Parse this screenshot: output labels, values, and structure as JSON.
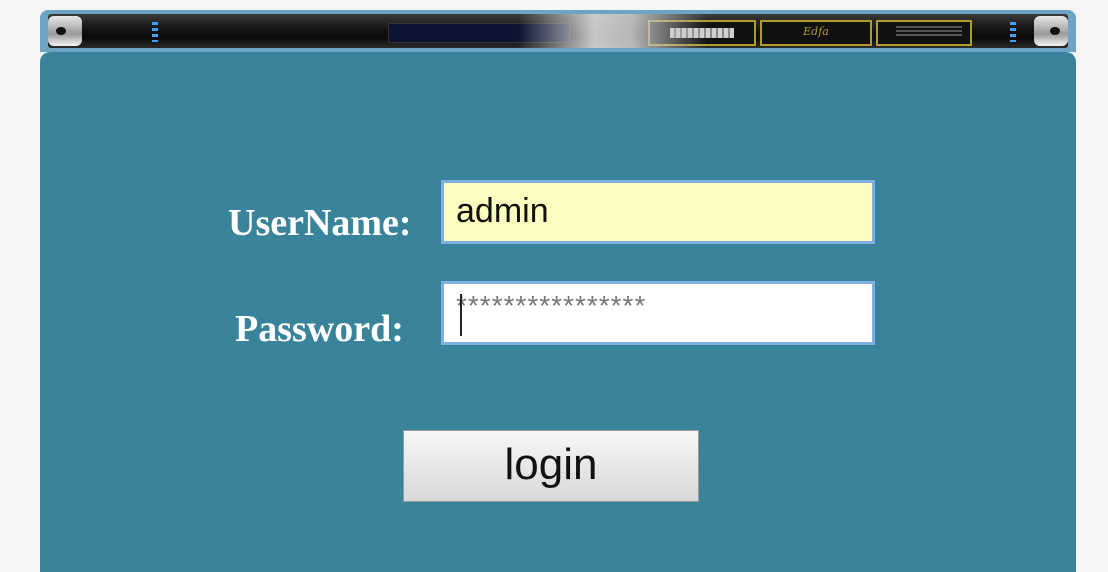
{
  "login_form": {
    "username_label": "UserName:",
    "username_value": "admin",
    "password_label": "Password:",
    "password_value": "****************",
    "login_button": "login"
  },
  "colors": {
    "panel_background": "#39849b",
    "username_field_background": "#fcfcc0",
    "field_border": "#7fb1e0",
    "label_text": "#ffffff"
  },
  "icons": {
    "device_banner": "rack-mounted-device-front-panel"
  }
}
